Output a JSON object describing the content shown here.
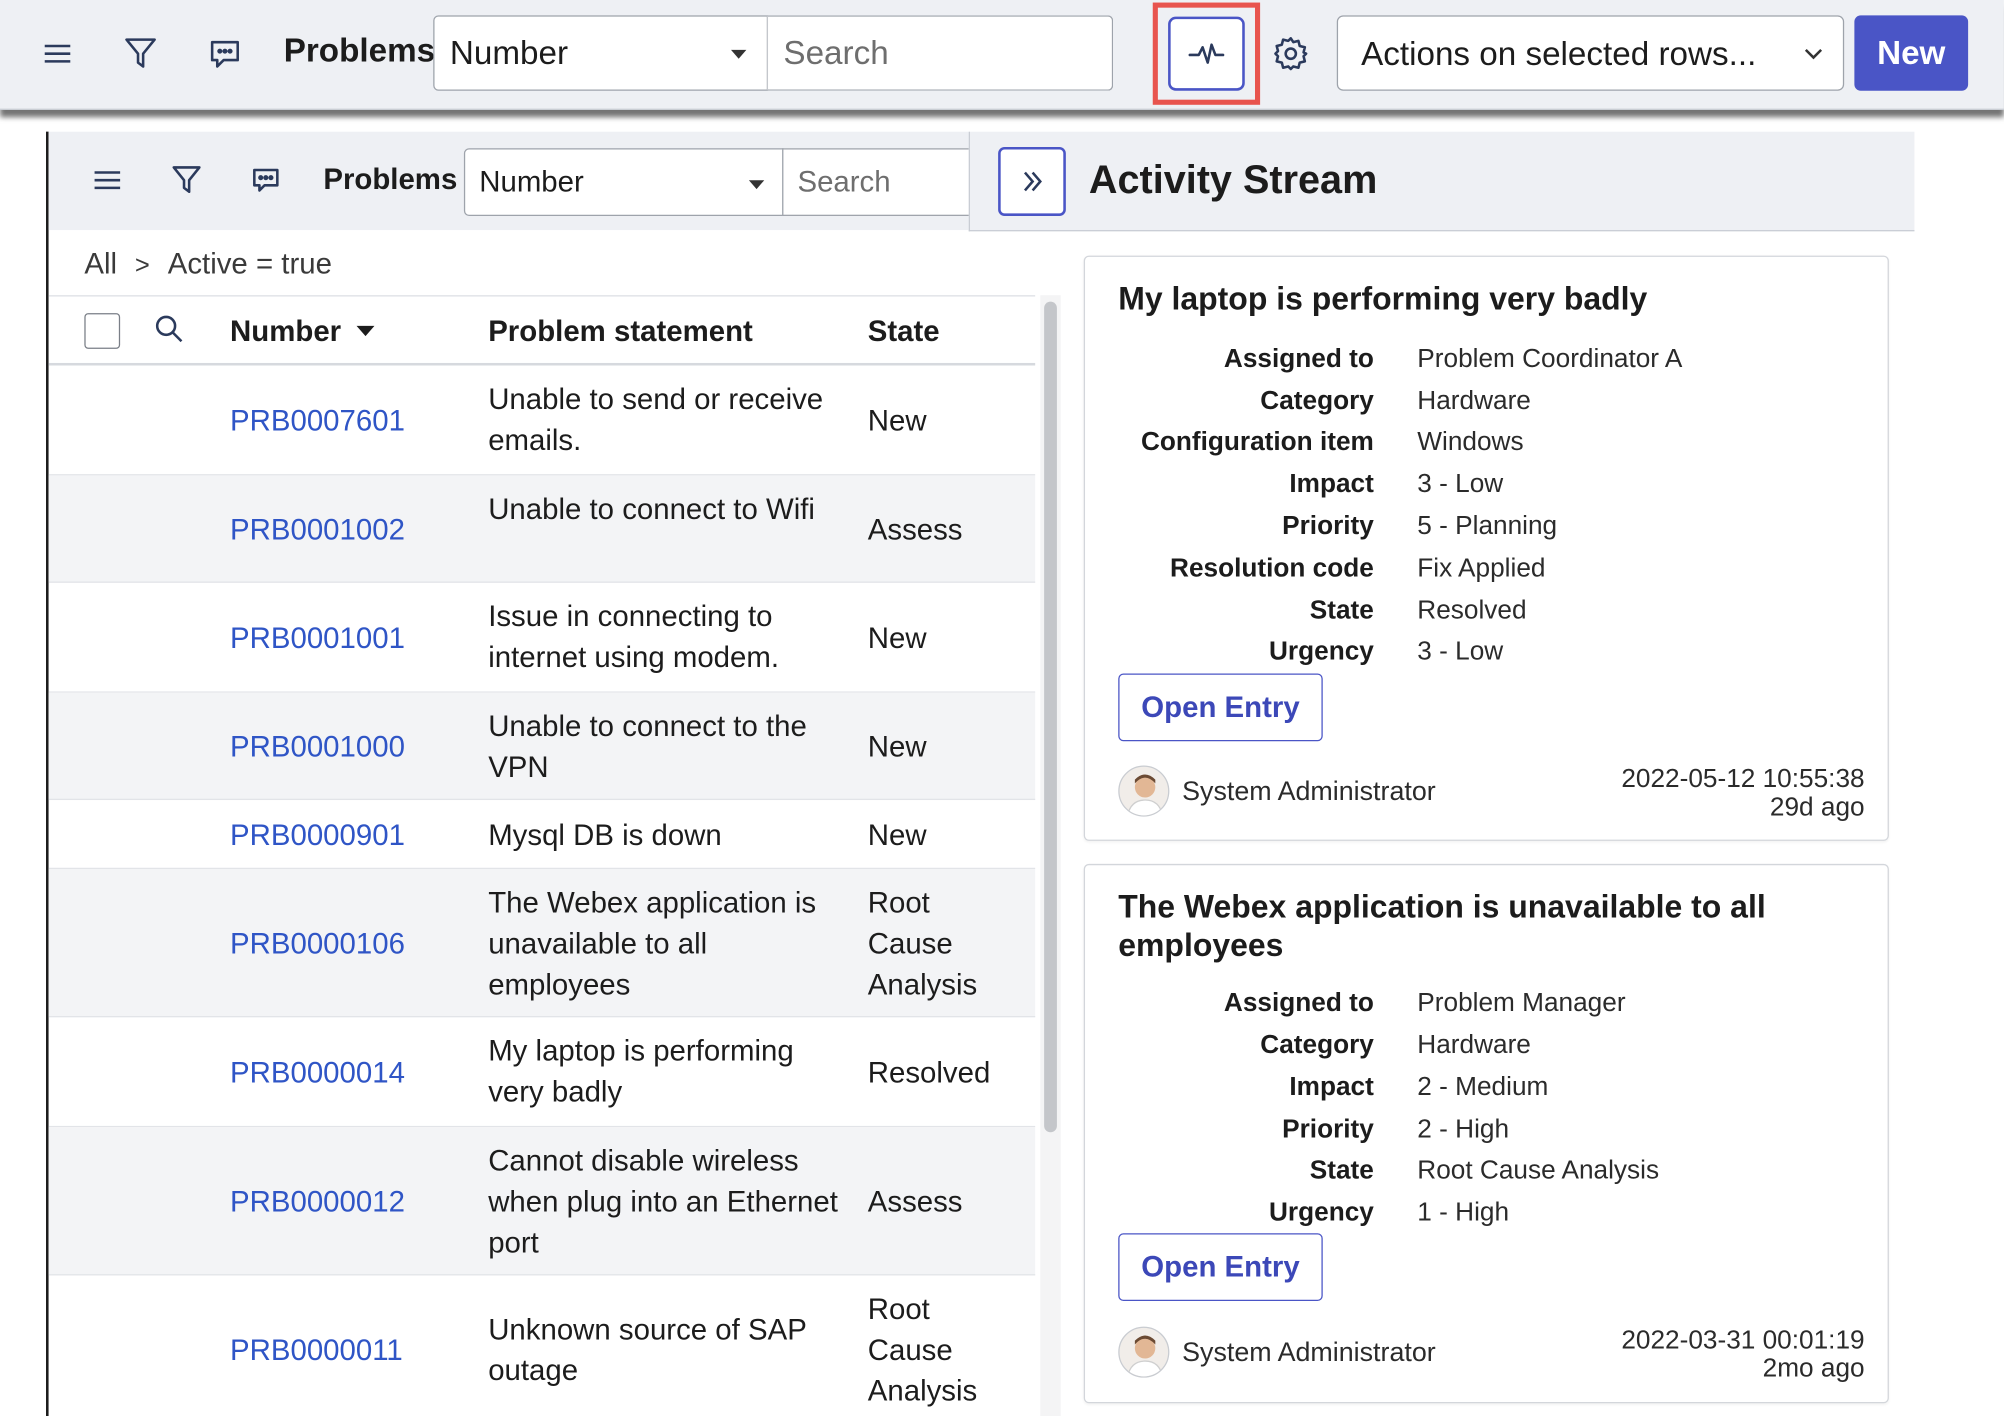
{
  "toolbar": {
    "title": "Problems",
    "field_select": "Number",
    "search_placeholder": "Search",
    "actions_select": "Actions on selected rows...",
    "new_label": "New"
  },
  "list_header": {
    "title": "Problems",
    "field_select": "Number",
    "search_placeholder": "Search"
  },
  "breadcrumb": {
    "all": "All",
    "separator": ">",
    "filter": "Active = true"
  },
  "columns": {
    "number": "Number",
    "statement": "Problem statement",
    "state": "State"
  },
  "rows": [
    {
      "number": "PRB0007601",
      "statement": "Unable to send or receive emails.",
      "state": "New"
    },
    {
      "number": "PRB0001002",
      "statement": "Unable to connect to Wifi",
      "state": "Assess"
    },
    {
      "number": "PRB0001001",
      "statement": "Issue in connecting to internet using modem.",
      "state": "New"
    },
    {
      "number": "PRB0001000",
      "statement": "Unable to connect to the VPN",
      "state": "New"
    },
    {
      "number": "PRB0000901",
      "statement": "Mysql DB is down",
      "state": "New"
    },
    {
      "number": "PRB0000106",
      "statement": "The Webex application is unavailable to all employees",
      "state": "Root Cause Analysis"
    },
    {
      "number": "PRB0000014",
      "statement": "My laptop is performing very badly",
      "state": "Resolved"
    },
    {
      "number": "PRB0000012",
      "statement": "Cannot disable wireless when plug into an Ethernet port",
      "state": "Assess"
    },
    {
      "number": "PRB0000011",
      "statement": "Unknown source of SAP outage",
      "state": "Root Cause Analysis"
    }
  ],
  "activity": {
    "title": "Activity Stream",
    "cards": [
      {
        "title": "My laptop is performing very badly",
        "fields": [
          {
            "label": "Assigned to",
            "value": "Problem Coordinator A"
          },
          {
            "label": "Category",
            "value": "Hardware"
          },
          {
            "label": "Configuration item",
            "value": "Windows"
          },
          {
            "label": "Impact",
            "value": "3 - Low"
          },
          {
            "label": "Priority",
            "value": "5 - Planning"
          },
          {
            "label": "Resolution code",
            "value": "Fix Applied"
          },
          {
            "label": "State",
            "value": "Resolved"
          },
          {
            "label": "Urgency",
            "value": "3 - Low"
          }
        ],
        "button": "Open Entry",
        "author": "System Administrator",
        "timestamp": "2022-05-12 10:55:38",
        "relative": "29d ago"
      },
      {
        "title": "The Webex application is unavailable to all employees",
        "fields": [
          {
            "label": "Assigned to",
            "value": "Problem Manager"
          },
          {
            "label": "Category",
            "value": "Hardware"
          },
          {
            "label": "Impact",
            "value": "2 - Medium"
          },
          {
            "label": "Priority",
            "value": "2 - High"
          },
          {
            "label": "State",
            "value": "Root Cause Analysis"
          },
          {
            "label": "Urgency",
            "value": "1 - High"
          }
        ],
        "button": "Open Entry",
        "author": "System Administrator",
        "timestamp": "2022-03-31 00:01:19",
        "relative": "2mo ago"
      }
    ]
  },
  "colors": {
    "accent": "#4a55c6",
    "link": "#2f55c6",
    "highlight": "#e8544e",
    "toolbar_bg": "#eef0f4"
  },
  "icons": [
    "hamburger-icon",
    "filter-icon",
    "comment-icon",
    "activity-pulse-icon",
    "gear-icon",
    "chevron-down-icon",
    "search-icon",
    "double-chevron-right-icon",
    "avatar-icon"
  ]
}
